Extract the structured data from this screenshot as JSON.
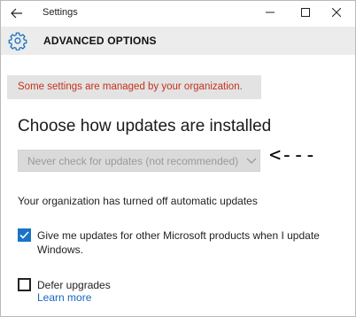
{
  "window": {
    "title": "Settings",
    "back_icon": "arrow-left-icon",
    "controls": [
      "minimize-icon",
      "maximize-icon",
      "close-icon"
    ]
  },
  "header": {
    "icon": "gear-icon",
    "title": "ADVANCED OPTIONS"
  },
  "banner": {
    "text": "Some settings are managed by your organization.",
    "color": "#c4321c"
  },
  "updates": {
    "heading": "Choose how updates are installed",
    "dropdown_value": "Never check for updates (not recommended)",
    "dropdown_disabled": true,
    "annotation": "<---"
  },
  "org_notice": "Your organization has turned off automatic updates",
  "options": [
    {
      "label": "Give me updates for other Microsoft products when I update Windows.",
      "checked": true
    },
    {
      "label": "Defer upgrades",
      "checked": false
    }
  ],
  "learn_more": "Learn more",
  "colors": {
    "accent": "#1a73c9",
    "link": "#1565c0",
    "header_bg": "#ececec"
  }
}
